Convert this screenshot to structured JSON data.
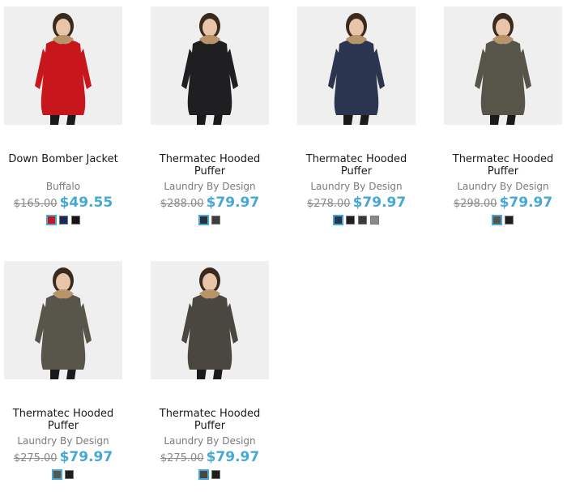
{
  "products": [
    {
      "name": "Down Bomber Jacket",
      "brand": "Buffalo",
      "old_price": "$165.00",
      "price": "$49.55",
      "coat_color": "#c8161d",
      "swatches": [
        "#c8161d",
        "#1b2a5c",
        "#151515"
      ]
    },
    {
      "name": "Thermatec Hooded Puffer",
      "brand": "Laundry By Design",
      "old_price": "$288.00",
      "price": "$79.97",
      "coat_color": "#1f1f21",
      "swatches": [
        "#2a2f38",
        "#3d3d3d"
      ]
    },
    {
      "name": "Thermatec Hooded Puffer",
      "brand": "Laundry By Design",
      "old_price": "$278.00",
      "price": "$79.97",
      "coat_color": "#2b3550",
      "swatches": [
        "#2b3550",
        "#1e1e22",
        "#3a3a3a",
        "#8a8a8a"
      ]
    },
    {
      "name": "Thermatec Hooded Puffer",
      "brand": "Laundry By Design",
      "old_price": "$298.00",
      "price": "$79.97",
      "coat_color": "#57554a",
      "swatches": [
        "#57554a",
        "#1e1e1e"
      ]
    },
    {
      "name": "Thermatec Hooded Puffer",
      "brand": "Laundry By Design",
      "old_price": "$275.00",
      "price": "$79.97",
      "coat_color": "#58564b",
      "swatches": [
        "#58564b",
        "#1e1e1e"
      ]
    },
    {
      "name": "Thermatec Hooded Puffer",
      "brand": "Laundry By Design",
      "old_price": "$275.00",
      "price": "$79.97",
      "coat_color": "#4a4741",
      "swatches": [
        "#4a4741",
        "#1e1e1e"
      ]
    }
  ]
}
